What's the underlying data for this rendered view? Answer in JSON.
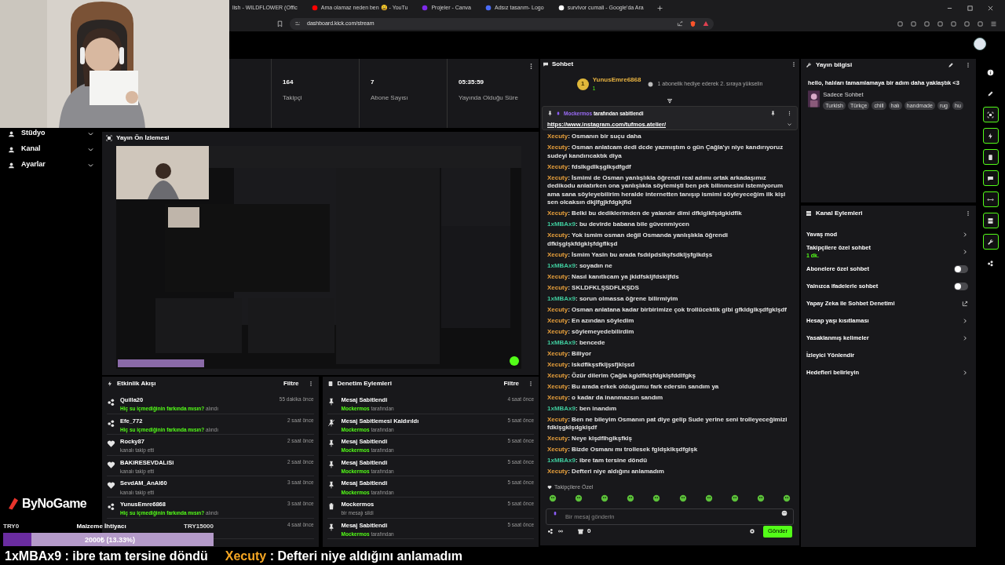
{
  "browser": {
    "tabs": [
      {
        "title": "lish - WILDFLOWER (Offic"
      },
      {
        "title": "Ama olamaz neden ben 😩 - YouTu"
      },
      {
        "title": "Projeler - Canva"
      },
      {
        "title": "Adsız tasarım- Logo"
      },
      {
        "title": "survivor cumali - Google'da Ara"
      }
    ],
    "url": "dashboard.kick.com/stream"
  },
  "sidebar": {
    "items": [
      {
        "label": "Stüdyo"
      },
      {
        "label": "Kanal"
      },
      {
        "label": "Ayarlar"
      }
    ]
  },
  "stats": [
    {
      "value": "164",
      "label": "Takipçi"
    },
    {
      "value": "7",
      "label": "Abone Sayısı"
    },
    {
      "value": "05:35:59",
      "label": "Yayında Olduğu Süre"
    }
  ],
  "preview": {
    "title": "Yayın Ön İzlemesi"
  },
  "activity": {
    "title": "Etkinlik Akışı",
    "filter": "Filtre",
    "events": [
      {
        "kind": "redeem",
        "name": "Quilla20",
        "reward": "Hiç su içmediğinin farkında mısın?",
        "action": "alındı",
        "time": "55 dakika önce"
      },
      {
        "kind": "redeem",
        "name": "Efe_772",
        "reward": "Hiç su içmediğinin farkında mısın?",
        "action": "alındı",
        "time": "2 saat önce"
      },
      {
        "kind": "follow",
        "name": "Rocky87",
        "action": "kanalı takip etti",
        "time": "2 saat önce"
      },
      {
        "kind": "follow",
        "name": "BAKiRESEVDALiSi",
        "action": "kanalı takip etti",
        "time": "2 saat önce"
      },
      {
        "kind": "follow",
        "name": "SevdAM_AnAl60",
        "action": "kanalı takip etti",
        "time": "3 saat önce"
      },
      {
        "kind": "redeem",
        "name": "YunusEmre6868",
        "reward": "Hiç su içmediğinin farkında mısın?",
        "action": "alındı",
        "time": "3 saat önce"
      },
      {
        "time": "4 saat önce"
      }
    ]
  },
  "moderation": {
    "title": "Denetim Eylemleri",
    "filter": "Filtre",
    "actions": [
      {
        "kind": "pin",
        "title": "Mesaj Sabitlendi",
        "actor": "Mockermos",
        "detail": "tarafından",
        "time": "4 saat önce"
      },
      {
        "kind": "unpin",
        "title": "Mesaj Sabitlemesi Kaldırıldı",
        "actor": "Mockermos",
        "detail": "tarafından",
        "time": "5 saat önce"
      },
      {
        "kind": "pin",
        "title": "Mesaj Sabitlendi",
        "actor": "Mockermos",
        "detail": "tarafından",
        "time": "5 saat önce"
      },
      {
        "kind": "pin",
        "title": "Mesaj Sabitlendi",
        "actor": "Mockermos",
        "detail": "tarafından",
        "time": "5 saat önce"
      },
      {
        "kind": "pin",
        "title": "Mesaj Sabitlendi",
        "actor": "Mockermos",
        "detail": "tarafından",
        "time": "5 saat önce"
      },
      {
        "kind": "delete",
        "title": "Mockermos",
        "detail": "bir mesajı sildi",
        "time": "5 saat önce"
      },
      {
        "kind": "pin",
        "title": "Mesaj Sabitlendi",
        "actor": "Mockermos",
        "detail": "tarafından",
        "time": "5 saat önce"
      }
    ]
  },
  "chat": {
    "title": "Sohbet",
    "top_gifter": {
      "rank": "1",
      "name": "YunusEmre6868",
      "count": "1",
      "hint": "1 abonelik hediye ederek 2. sıraya yükselin"
    },
    "pinned": {
      "author": "Mockermos",
      "note": "tarafından sabitlendi",
      "link": "https://www.instagram.com/tufmos.atelier/"
    },
    "messages": [
      {
        "user": "Xecuty",
        "color": "#e8a03c",
        "text": ": Osmanın bir suçu daha"
      },
      {
        "user": "Xecuty",
        "color": "#e8a03c",
        "text": ": Osman anlatcam dedi dcde yazmıştım o gün Çağla'yı niye kandırıyoruz sudeyi kandırıcaktık diya"
      },
      {
        "user": "Xecuty",
        "color": "#e8a03c",
        "text": ": fdslkgdlkşglkşdfgdf"
      },
      {
        "user": "Xecuty",
        "color": "#e8a03c",
        "text": ": İsmimi de Osman yanlışlıkla öğrendi real adımı ortak arkadaşımız dedikodu anlatırken ona yanlışlıkla söylemişti ben pek bilinmesini istemiyorum ama sana söyleyebilirim heralde internetten tanışıp ismimi söyleyeceğim ilk kişi sen olcaksın dkjlfgjkfdgkjfld"
      },
      {
        "user": "Xecuty",
        "color": "#e8a03c",
        "text": ": Belki bu dediklerimden de yalandır dimi dfklglkfşdgkldflk"
      },
      {
        "user": "1xMBAx9",
        "color": "#3fc99c",
        "text": ": bu devirde babana bile güvenmiycen"
      },
      {
        "user": "Xecuty",
        "color": "#e8a03c",
        "text": ": Yok ismim osman değil Osmanda yanlışlıkla öğrendi dfklşglşkfdgklşfdgflkşd"
      },
      {
        "user": "Xecuty",
        "color": "#e8a03c",
        "text": ": İsmim Yasin bu arada fsdılpdslkşfsdkljşfglkdşs"
      },
      {
        "user": "1xMBAx9",
        "color": "#3fc99c",
        "text": ": soyadın ne"
      },
      {
        "user": "Xecuty",
        "color": "#e8a03c",
        "text": ": Nasıl kanıtlıcam ya jkldfskljfdskljfds"
      },
      {
        "user": "Xecuty",
        "color": "#e8a03c",
        "text": ": SKLDFKLŞSDFLKŞDS"
      },
      {
        "user": "1xMBAx9",
        "color": "#3fc99c",
        "text": ": sorun olmassa öğrene bilirmiyim"
      },
      {
        "user": "Xecuty",
        "color": "#e8a03c",
        "text": ": Osman anlatana kadar birbirimize çok trollücektik gibi gfkldglkşdfgklşdf"
      },
      {
        "user": "Xecuty",
        "color": "#e8a03c",
        "text": ": En azından söyledim"
      },
      {
        "user": "Xecuty",
        "color": "#e8a03c",
        "text": ": söylemeyedebilirdim"
      },
      {
        "user": "1xMBAx9",
        "color": "#3fc99c",
        "text": ": bencede"
      },
      {
        "user": "Xecuty",
        "color": "#e8a03c",
        "text": ": Biliyor"
      },
      {
        "user": "Xecuty",
        "color": "#e8a03c",
        "text": ": lskdflkşsfkljşsfjklşsd"
      },
      {
        "user": "Xecuty",
        "color": "#e8a03c",
        "text": ": Özür dilerim Çağla kgldfklşfdgklşfddlfgkş"
      },
      {
        "user": "Xecuty",
        "color": "#e8a03c",
        "text": ": Bu arada erkek olduğumu fark edersin sandım ya"
      },
      {
        "user": "Xecuty",
        "color": "#e8a03c",
        "text": ": o kadar da inanmazsın sandım"
      },
      {
        "user": "1xMBAx9",
        "color": "#3fc99c",
        "text": ": ben inandım"
      },
      {
        "user": "Xecuty",
        "color": "#e8a03c",
        "text": ": Ben ne bileyim Osmanın pat diye gelip Sude yerine seni trolleyeceğimizi fdklşgklşdgklşdf"
      },
      {
        "user": "Xecuty",
        "color": "#e8a03c",
        "text": ": Neye klşdflhglkşfklş"
      },
      {
        "user": "Xecuty",
        "color": "#e8a03c",
        "text": ": Bizde Osmanı mı trollesek fgldşklkşdfglşk"
      },
      {
        "user": "1xMBAx9",
        "color": "#3fc99c",
        "text": ": ibre tam tersine döndü"
      },
      {
        "user": "Xecuty",
        "color": "#e8a03c",
        "text": ": Defteri niye aldığını anlamadım"
      }
    ],
    "emote_section": "Takipçilere Özel",
    "placeholder": "Bir mesaj gönderin",
    "count": "0",
    "send": "Gönder"
  },
  "stream_info": {
    "title": "Yayın bilgisi",
    "headline": "hello, halıları tamamlamaya bir adım daha yaklaştık <3",
    "category": "Sadece Sohbet",
    "tags": [
      "Turkish",
      "Türkçe",
      "chill",
      "halı",
      "handmade",
      "rug",
      "hu"
    ]
  },
  "channel_actions": {
    "title": "Kanal Eylemleri",
    "items": [
      {
        "kind": "chevron",
        "label": "Yavaş mod"
      },
      {
        "kind": "chevron",
        "label": "Takipçilere özel sohbet",
        "detail": "1 dk."
      },
      {
        "kind": "toggle",
        "label": "Abonelere özel sohbet",
        "on": false
      },
      {
        "kind": "toggle",
        "label": "Yalnızca ifadelerle sohbet",
        "on": false
      },
      {
        "kind": "external",
        "label": "Yapay Zeka ile Sohbet Denetimi"
      },
      {
        "kind": "chevron",
        "label": "Hesap yaşı kısıtlaması"
      },
      {
        "kind": "chevron",
        "label": "Yasaklanmış kelimeler"
      },
      {
        "kind": "plain",
        "label": "İzleyici Yönlendir"
      },
      {
        "kind": "chevron",
        "label": "Hedefleri belirleyin"
      }
    ]
  },
  "rail": [
    {
      "kind": "info",
      "active": false
    },
    {
      "kind": "pencil",
      "active": false
    },
    {
      "kind": "focus",
      "active": true
    },
    {
      "kind": "bolt",
      "active": true
    },
    {
      "kind": "doc",
      "active": true
    },
    {
      "kind": "chat",
      "active": true
    },
    {
      "kind": "arrows",
      "active": true
    },
    {
      "kind": "channel",
      "active": true
    },
    {
      "kind": "wrench",
      "active": true
    },
    {
      "kind": "share",
      "active": false
    }
  ],
  "overlay": {
    "logo": "ByNoGame",
    "goal": {
      "title": "Malzeme İhtiyacı",
      "amount": "2000₺ (13.33%)",
      "level": 0.1333,
      "min": "TRY0",
      "max": "TRY15000"
    },
    "ticker": [
      {
        "user": "1xMBAx9",
        "color": "#ffffff",
        "text": " : ibre tam tersine döndü"
      },
      {
        "user": "Xecuty",
        "color": "#f5a623",
        "text": " : Defteri niye aldığını anlamadım"
      }
    ]
  }
}
